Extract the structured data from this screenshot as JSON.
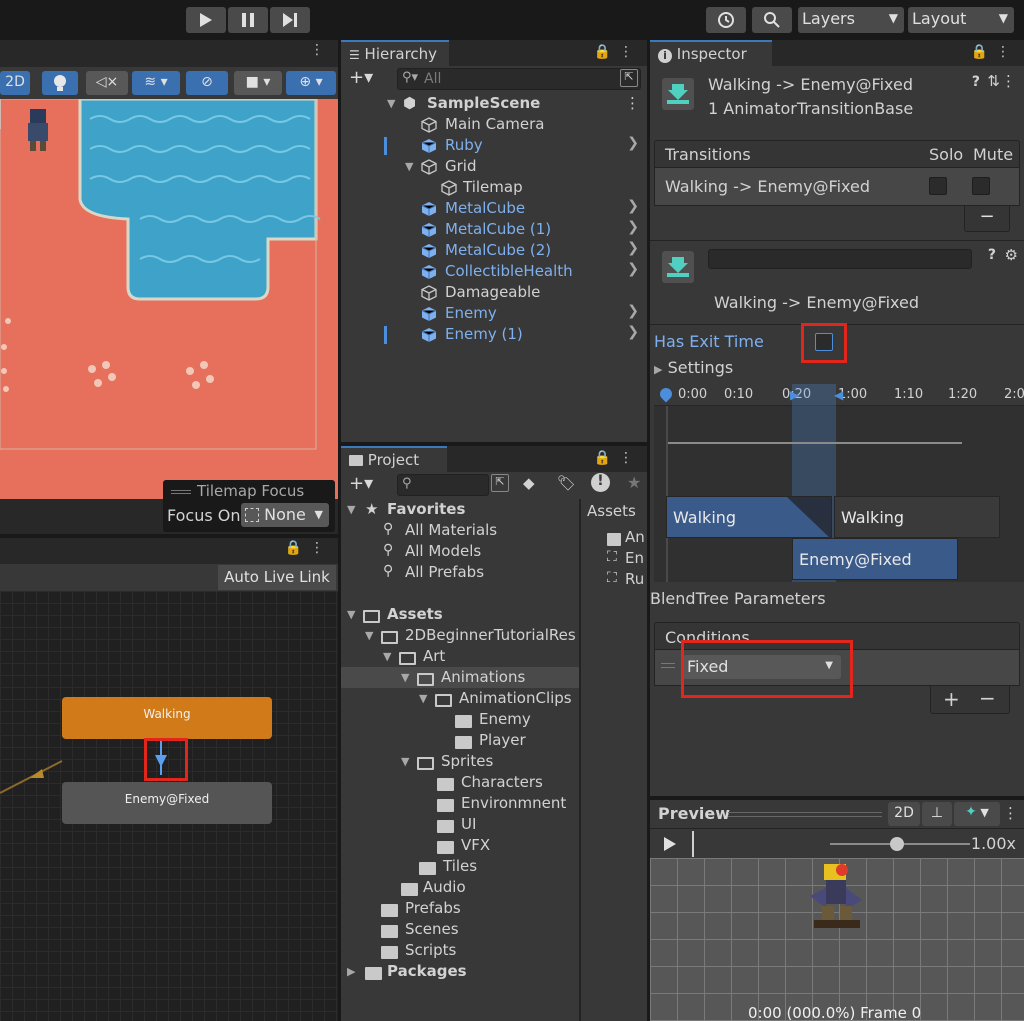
{
  "toolbar": {
    "layers_label": "Layers",
    "layout_label": "Layout"
  },
  "scene": {
    "mode_2d": "2D",
    "tilemap_focus_title": "Tilemap Focus",
    "focus_on_label": "Focus On",
    "focus_on_value": "None"
  },
  "animator": {
    "auto_live_link": "Auto Live Link",
    "state_walking": "Walking",
    "state_enemy": "Enemy@Fixed"
  },
  "hierarchy": {
    "tab": "Hierarchy",
    "search_placeholder": "All",
    "scene_name": "SampleScene",
    "items": [
      {
        "label": "Main Camera"
      },
      {
        "label": "Ruby"
      },
      {
        "label": "Grid"
      },
      {
        "label": "Tilemap"
      },
      {
        "label": "MetalCube"
      },
      {
        "label": "MetalCube (1)"
      },
      {
        "label": "MetalCube (2)"
      },
      {
        "label": "CollectibleHealth"
      },
      {
        "label": "Damageable"
      },
      {
        "label": "Enemy"
      },
      {
        "label": "Enemy (1)"
      }
    ]
  },
  "project": {
    "tab": "Project",
    "favorites": "Favorites",
    "fav_items": [
      "All Materials",
      "All Models",
      "All Prefabs"
    ],
    "assets": "Assets",
    "tree": [
      {
        "label": "2DBeginnerTutorialRes"
      },
      {
        "label": "Art"
      },
      {
        "label": "Animations"
      },
      {
        "label": "AnimationClips"
      },
      {
        "label": "Enemy"
      },
      {
        "label": "Player"
      },
      {
        "label": "Sprites"
      },
      {
        "label": "Characters"
      },
      {
        "label": "Environmnent"
      },
      {
        "label": "UI"
      },
      {
        "label": "VFX"
      },
      {
        "label": "Tiles"
      },
      {
        "label": "Audio"
      },
      {
        "label": "Prefabs"
      },
      {
        "label": "Scenes"
      },
      {
        "label": "Scripts"
      }
    ],
    "packages": "Packages",
    "right_header": "Assets",
    "right_items": [
      "An",
      "En",
      "Ru"
    ]
  },
  "inspector": {
    "tab": "Inspector",
    "title": "Walking -> Enemy@Fixed",
    "subtitle": "1 AnimatorTransitionBase",
    "transitions_header": "Transitions",
    "solo": "Solo",
    "mute": "Mute",
    "transition_row": "Walking -> Enemy@Fixed",
    "transition_name": "Walking -> Enemy@Fixed",
    "has_exit_time": "Has Exit Time",
    "settings": "Settings",
    "timeline_ticks": [
      "0:00",
      "0:10",
      "0:20",
      "1:00",
      "1:10",
      "1:20",
      "2:0"
    ],
    "clip_walking_a": "Walking",
    "clip_walking_b": "Walking",
    "clip_enemy": "Enemy@Fixed",
    "blendtree_params": "BlendTree Parameters",
    "conditions_header": "Conditions",
    "condition_value": "Fixed"
  },
  "preview": {
    "title": "Preview",
    "mode_2d": "2D",
    "speed": "1.00x",
    "frame_info": "0:00 (000.0%) Frame 0"
  }
}
